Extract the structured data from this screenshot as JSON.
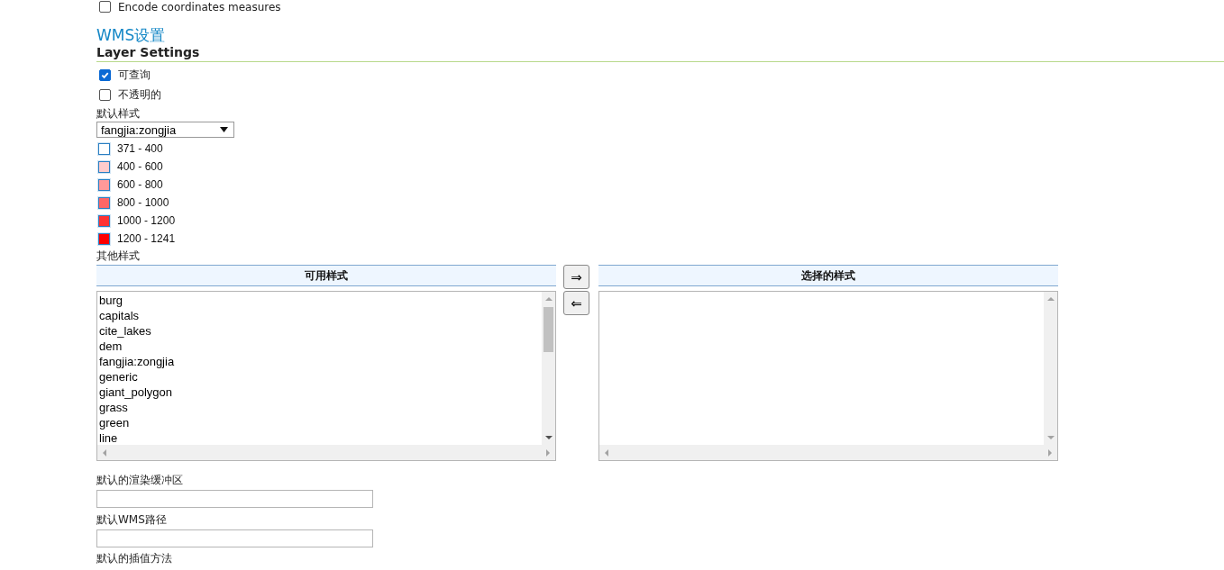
{
  "top_option": {
    "label": "Encode coordinates measures",
    "checked": false
  },
  "section_title": "WMS设置",
  "subsection_title": "Layer Settings",
  "options": [
    {
      "label": "可查询",
      "checked": true
    },
    {
      "label": "不透明的",
      "checked": false
    }
  ],
  "default_style": {
    "label": "默认样式",
    "value": "fangjia:zongjia"
  },
  "legend": [
    {
      "label": "371 - 400",
      "color": "#ffffff"
    },
    {
      "label": "400 - 600",
      "color": "#ffcccc"
    },
    {
      "label": "600 - 800",
      "color": "#ff9999"
    },
    {
      "label": "800 - 1000",
      "color": "#ff6666"
    },
    {
      "label": "1000 - 1200",
      "color": "#ff3333"
    },
    {
      "label": "1200 - 1241",
      "color": "#ff0000"
    }
  ],
  "other_styles": {
    "label": "其他样式",
    "available": {
      "title": "可用样式",
      "items": [
        "burg",
        "capitals",
        "cite_lakes",
        "dem",
        "fangjia:zongjia",
        "generic",
        "giant_polygon",
        "grass",
        "green",
        "line"
      ]
    },
    "buttons": [
      "⇒",
      "⇐"
    ],
    "selected": {
      "title": "选择的样式"
    }
  },
  "fields": [
    {
      "label": "默认的渲染缓冲区"
    },
    {
      "label": "默认WMS路径"
    }
  ],
  "last_label": "默认的插值方法"
}
